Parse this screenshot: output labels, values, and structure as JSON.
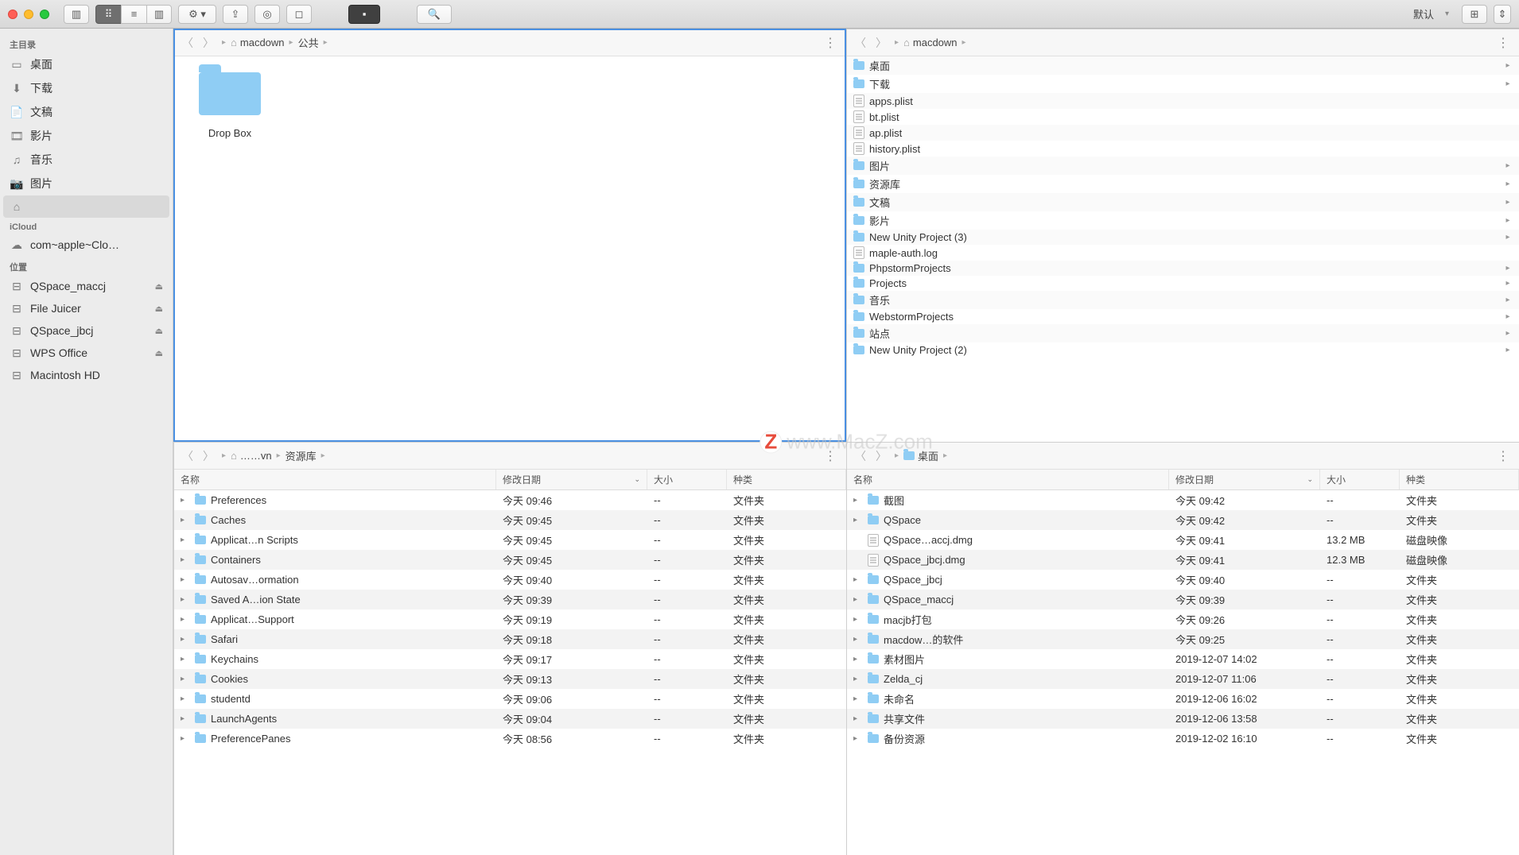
{
  "watermark": "www.MacZ.com",
  "toolbar": {
    "default_label": "默认",
    "sidebar_toggle": "▢",
    "view_icons": "⊞",
    "view_list": "≡",
    "view_cols": "▥",
    "gear": "⚙",
    "share": "⇪",
    "airdrop": "◎",
    "tag": "⌂",
    "terminal": "■",
    "search": "🔍"
  },
  "sidebar": {
    "sections": [
      {
        "title": "主目录",
        "items": [
          {
            "icon": "desktop",
            "label": "桌面"
          },
          {
            "icon": "download",
            "label": "下载"
          },
          {
            "icon": "doc",
            "label": "文稿"
          },
          {
            "icon": "film",
            "label": "影片"
          },
          {
            "icon": "music",
            "label": "音乐"
          },
          {
            "icon": "pic",
            "label": "图片"
          },
          {
            "icon": "home",
            "label": "",
            "selected": true
          }
        ]
      },
      {
        "title": "iCloud",
        "items": [
          {
            "icon": "cloud",
            "label": "com~apple~Clo…"
          }
        ]
      },
      {
        "title": "位置",
        "items": [
          {
            "icon": "disk",
            "label": "QSpace_maccj",
            "eject": true
          },
          {
            "icon": "disk",
            "label": "File Juicer",
            "eject": true
          },
          {
            "icon": "disk",
            "label": "QSpace_jbcj",
            "eject": true
          },
          {
            "icon": "disk",
            "label": "WPS Office",
            "eject": true
          },
          {
            "icon": "disk",
            "label": "Macintosh HD"
          }
        ]
      }
    ]
  },
  "pane1": {
    "crumbs": [
      "macdown",
      "公共"
    ],
    "items": [
      {
        "name": "Drop Box"
      }
    ]
  },
  "pane2": {
    "crumbs": [
      "macdown"
    ],
    "items": [
      {
        "type": "folder",
        "name": "桌面",
        "arrow": true
      },
      {
        "type": "folder",
        "name": "下载",
        "arrow": true
      },
      {
        "type": "file",
        "name": "apps.plist"
      },
      {
        "type": "file",
        "name": "bt.plist"
      },
      {
        "type": "file",
        "name": "ap.plist"
      },
      {
        "type": "file",
        "name": "history.plist"
      },
      {
        "type": "folder",
        "name": "图片",
        "arrow": true
      },
      {
        "type": "folder",
        "name": "资源库",
        "arrow": true
      },
      {
        "type": "folder",
        "name": "文稿",
        "arrow": true
      },
      {
        "type": "folder",
        "name": "影片",
        "arrow": true
      },
      {
        "type": "folder",
        "name": "New Unity Project (3)",
        "arrow": true
      },
      {
        "type": "log",
        "name": "maple-auth.log"
      },
      {
        "type": "folder",
        "name": "PhpstormProjects",
        "arrow": true
      },
      {
        "type": "folder",
        "name": "Projects",
        "arrow": true
      },
      {
        "type": "folder",
        "name": "音乐",
        "arrow": true
      },
      {
        "type": "folder",
        "name": "WebstormProjects",
        "arrow": true
      },
      {
        "type": "folder",
        "name": "站点",
        "arrow": true
      },
      {
        "type": "folder",
        "name": "New Unity Project (2)",
        "arrow": true
      }
    ]
  },
  "pane3": {
    "crumbs_home": "……vn",
    "crumbs_folder": "资源库",
    "cols": {
      "name": "名称",
      "date": "修改日期",
      "size": "大小",
      "kind": "种类"
    },
    "rows": [
      {
        "name": "Preferences",
        "date": "今天 09:46",
        "size": "--",
        "kind": "文件夹"
      },
      {
        "name": "Caches",
        "date": "今天 09:45",
        "size": "--",
        "kind": "文件夹"
      },
      {
        "name": "Applicat…n Scripts",
        "date": "今天 09:45",
        "size": "--",
        "kind": "文件夹"
      },
      {
        "name": "Containers",
        "date": "今天 09:45",
        "size": "--",
        "kind": "文件夹"
      },
      {
        "name": "Autosav…ormation",
        "date": "今天 09:40",
        "size": "--",
        "kind": "文件夹"
      },
      {
        "name": "Saved A…ion State",
        "date": "今天 09:39",
        "size": "--",
        "kind": "文件夹"
      },
      {
        "name": "Applicat…Support",
        "date": "今天 09:19",
        "size": "--",
        "kind": "文件夹"
      },
      {
        "name": "Safari",
        "date": "今天 09:18",
        "size": "--",
        "kind": "文件夹"
      },
      {
        "name": "Keychains",
        "date": "今天 09:17",
        "size": "--",
        "kind": "文件夹"
      },
      {
        "name": "Cookies",
        "date": "今天 09:13",
        "size": "--",
        "kind": "文件夹"
      },
      {
        "name": "studentd",
        "date": "今天 09:06",
        "size": "--",
        "kind": "文件夹"
      },
      {
        "name": "LaunchAgents",
        "date": "今天 09:04",
        "size": "--",
        "kind": "文件夹"
      },
      {
        "name": "PreferencePanes",
        "date": "今天 08:56",
        "size": "--",
        "kind": "文件夹"
      }
    ]
  },
  "pane4": {
    "crumbs_folder": "桌面",
    "cols": {
      "name": "名称",
      "date": "修改日期",
      "size": "大小",
      "kind": "种类"
    },
    "rows": [
      {
        "tri": true,
        "icon": "folder",
        "name": "截图",
        "date": "今天 09:42",
        "size": "--",
        "kind": "文件夹"
      },
      {
        "tri": true,
        "icon": "folder",
        "name": "QSpace",
        "date": "今天 09:42",
        "size": "--",
        "kind": "文件夹"
      },
      {
        "tri": false,
        "icon": "dmg",
        "name": "QSpace…accj.dmg",
        "date": "今天 09:41",
        "size": "13.2 MB",
        "kind": "磁盘映像"
      },
      {
        "tri": false,
        "icon": "dmg",
        "name": "QSpace_jbcj.dmg",
        "date": "今天 09:41",
        "size": "12.3 MB",
        "kind": "磁盘映像"
      },
      {
        "tri": true,
        "icon": "folder",
        "name": "QSpace_jbcj",
        "date": "今天 09:40",
        "size": "--",
        "kind": "文件夹"
      },
      {
        "tri": true,
        "icon": "folder",
        "name": "QSpace_maccj",
        "date": "今天 09:39",
        "size": "--",
        "kind": "文件夹"
      },
      {
        "tri": true,
        "icon": "folder",
        "name": "macjb打包",
        "date": "今天 09:26",
        "size": "--",
        "kind": "文件夹"
      },
      {
        "tri": true,
        "icon": "folder",
        "name": "macdow…的软件",
        "date": "今天 09:25",
        "size": "--",
        "kind": "文件夹"
      },
      {
        "tri": true,
        "icon": "folder",
        "name": "素材图片",
        "date": "2019-12-07 14:02",
        "size": "--",
        "kind": "文件夹"
      },
      {
        "tri": true,
        "icon": "folder",
        "name": "Zelda_cj",
        "date": "2019-12-07 11:06",
        "size": "--",
        "kind": "文件夹"
      },
      {
        "tri": true,
        "icon": "folder",
        "name": "未命名",
        "date": "2019-12-06 16:02",
        "size": "--",
        "kind": "文件夹"
      },
      {
        "tri": true,
        "icon": "folder",
        "name": "共享文件",
        "date": "2019-12-06 13:58",
        "size": "--",
        "kind": "文件夹"
      },
      {
        "tri": true,
        "icon": "folder",
        "name": "备份资源",
        "date": "2019-12-02 16:10",
        "size": "--",
        "kind": "文件夹"
      }
    ]
  }
}
